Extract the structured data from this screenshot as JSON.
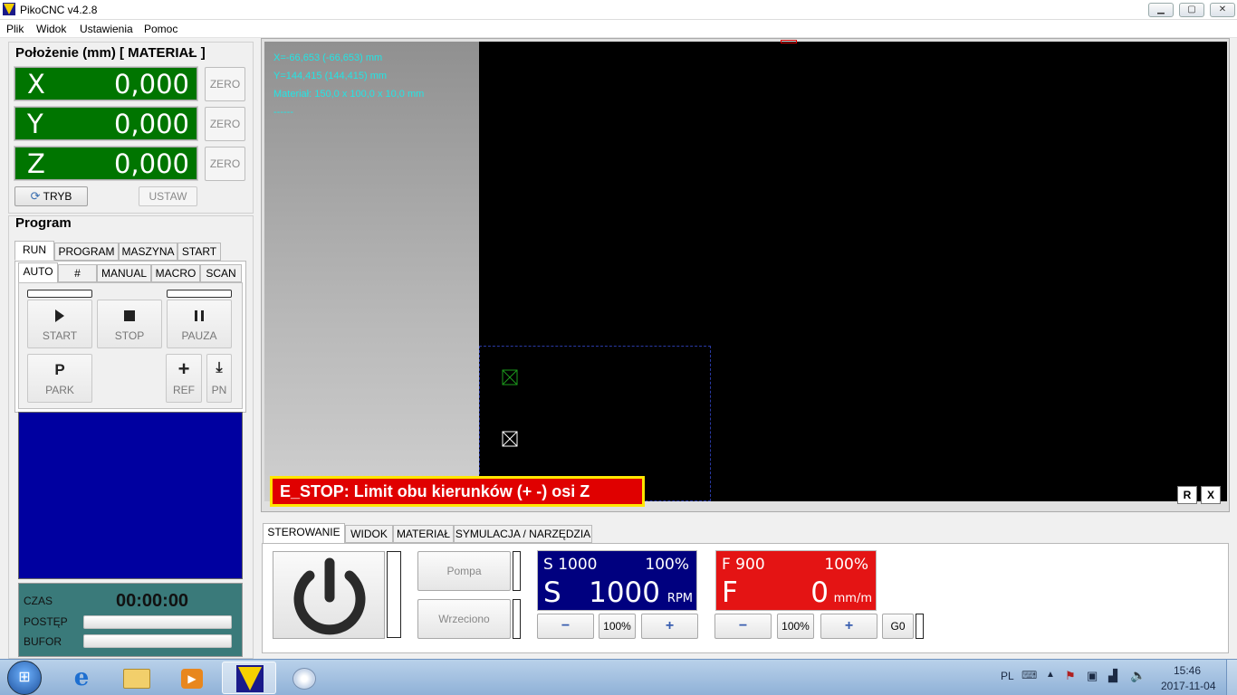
{
  "window": {
    "title": "PikoCNC v4.2.8"
  },
  "menu": [
    "Plik",
    "Widok",
    "Ustawienia",
    "Pomoc"
  ],
  "position": {
    "title": "Położenie (mm) [ MATERIAŁ ]",
    "axes": [
      {
        "axis": "X",
        "value": "0,000",
        "zero": "ZERO"
      },
      {
        "axis": "Y",
        "value": "0,000",
        "zero": "ZERO"
      },
      {
        "axis": "Z",
        "value": "0,000",
        "zero": "ZERO"
      }
    ],
    "mode_button": "TRYB",
    "set_button": "USTAW"
  },
  "program": {
    "title": "Program",
    "tabs": [
      "RUN",
      "PROGRAM",
      "MASZYNA",
      "START"
    ],
    "subtabs": [
      "AUTO",
      "#",
      "MANUAL",
      "MACRO",
      "SCAN"
    ],
    "buttons": {
      "start": "START",
      "stop": "STOP",
      "pause": "PAUZA",
      "park": "PARK",
      "ref": "REF",
      "pn": "PN"
    },
    "status": {
      "time_label": "CZAS",
      "time_value": "00:00:00",
      "progress_label": "POSTĘP",
      "buffer_label": "BUFOR"
    }
  },
  "viewport": {
    "info": [
      "X=-66,653 (-66,653) mm",
      "Y=144,415 (144,415) mm",
      "Materiał: 150,0 x 100,0 x 10,0 mm",
      "------"
    ],
    "estop_message": "E_STOP: Limit obu kierunków (+ -) osi Z",
    "reset_button": "R",
    "close_button": "X"
  },
  "control": {
    "tabs": [
      "STEROWANIE",
      "WIDOK",
      "MATERIAŁ",
      "SYMULACJA / NARZĘDZIA"
    ],
    "pump_button": "Pompa",
    "spindle_button": "Wrzeciono",
    "spindle": {
      "set_label": "S 1000",
      "override": "100%",
      "letter": "S",
      "value": "1000",
      "unit": "RPM",
      "color": "#00007f"
    },
    "feed": {
      "set_label": "F 900",
      "override": "100%",
      "letter": "F",
      "value": "0",
      "unit": "mm/m",
      "color": "#e41414"
    },
    "percent_button": "100%",
    "g0_button": "G0"
  },
  "taskbar": {
    "language": "PL",
    "time": "15:46",
    "date": "2017-11-04"
  }
}
